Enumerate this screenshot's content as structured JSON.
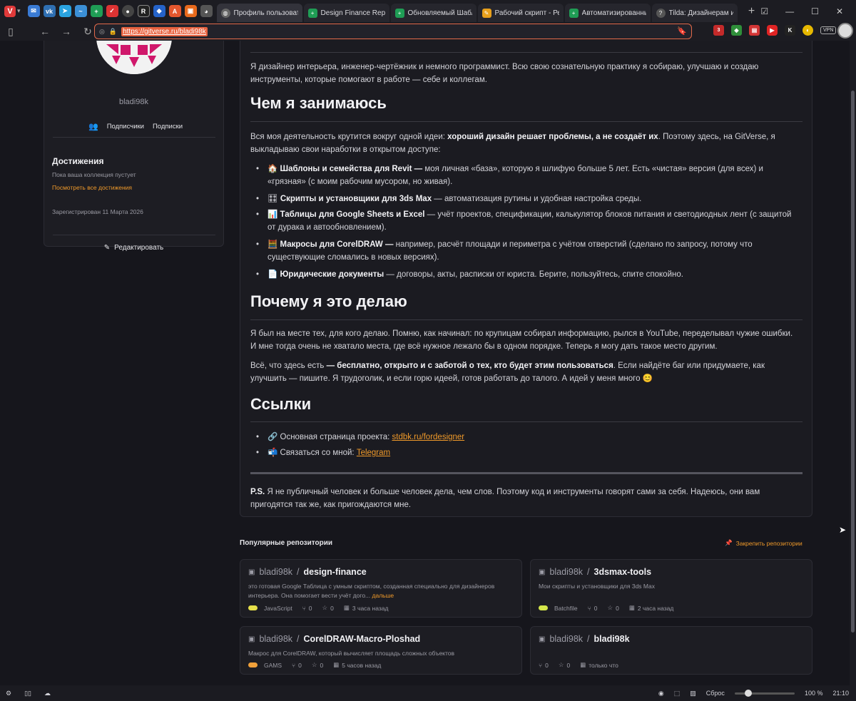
{
  "browser": {
    "tabs": [
      {
        "title": "Профиль пользователя G",
        "active": true,
        "icon": "profile-tab-icon"
      },
      {
        "title": "Design Finance Repository",
        "active": false,
        "icon": "sheets-icon"
      },
      {
        "title": "Обновляемый Шаблон у",
        "active": false,
        "icon": "sheets-icon"
      },
      {
        "title": "Рабочий скрипт - Редакт",
        "active": false,
        "icon": "script-icon"
      },
      {
        "title": "Автоматизированный Ка",
        "active": false,
        "icon": "sheets-icon"
      },
      {
        "title": "Tilda: Дизайнерам и студ",
        "active": false,
        "icon": "help-icon"
      }
    ],
    "url": "https://gitverse.ru/bladi98k",
    "vpn_label": "VPN",
    "badge_count": "3"
  },
  "profile": {
    "username": "bladi98k",
    "followers_label": "Подписчики",
    "following_label": "Подписки",
    "achievements_title": "Достижения",
    "achievements_empty": "Пока ваша коллекция пустует",
    "achievements_link": "Посмотреть все достижения",
    "registered": "Зарегистрирован 11 Марта 2026",
    "edit_label": "Редактировать"
  },
  "readme": {
    "intro": "Я дизайнер интерьера, инженер-чертёжник и немного программист. Всю свою сознательную практику я собираю, улучшаю и создаю инструменты, которые помогают в работе — себе и коллегам.",
    "h_what": "Чем я занимаюсь",
    "what_p_a": "Вся моя деятельность крутится вокруг одной идеи: ",
    "what_p_b": "хороший дизайн решает проблемы, а не создаёт их",
    "what_p_c": ". Поэтому здесь, на GitVerse, я выкладываю свои наработки в открытом доступе:",
    "items": [
      {
        "emoji": "🏠",
        "bold": "Шаблоны и семейства для Revit —",
        "text": " моя личная «база», которую я шлифую больше 5 лет. Есть «чистая» версия (для всех) и «грязная» (с моим рабочим мусором, но живая)."
      },
      {
        "emoji": "🎛",
        "bold": "Скрипты и установщики для 3ds Max",
        "text": " — автоматизация рутины и удобная настройка среды."
      },
      {
        "emoji": "📊",
        "bold": "Таблицы для Google Sheets и Excel",
        "text": " — учёт проектов, спецификации, калькулятор блоков питания и светодиодных лент (с защитой от дурака и автообновлением)."
      },
      {
        "emoji": "🧮",
        "bold": "Макросы для CorelDRAW —",
        "text": " например, расчёт площади и периметра с учётом отверстий (сделано по запросу, потому что существующие сломались в новых версиях)."
      },
      {
        "emoji": "📄",
        "bold": "Юридические документы",
        "text": " — договоры, акты, расписки от юриста. Берите, пользуйтесь, спите спокойно."
      }
    ],
    "h_why": "Почему я это делаю",
    "why_p1": "Я был на месте тех, для кого делаю. Помню, как начинал: по крупицам собирал информацию, рылся в YouTube, переделывал чужие ошибки. И мне тогда очень не хватало места, где всё нужное лежало бы в одном порядке. Теперь я могу дать такое место другим.",
    "why_p2_a": "Всё, что здесь есть ",
    "why_p2_b": "— бесплатно, открыто и с заботой о тех, кто будет этим пользоваться",
    "why_p2_c": ". Если найдёте баг или придумаете, как улучшить — пишите. Я трудоголик, и если горю идеей, готов работать до талого. А идей у меня много 😊",
    "h_links": "Ссылки",
    "link1_label": "🔗 Основная страница проекта: ",
    "link1_text": "stdbk.ru/fordesigner",
    "link2_label": "📬 Связаться со мной: ",
    "link2_text": "Telegram",
    "ps_bold": "P.S.",
    "ps_text": " Я не публичный человек и больше человек дела, чем слов. Поэтому код и инструменты говорят сами за себя. Надеюсь, они вам пригодятся так же, как пригождаются мне."
  },
  "repos": {
    "title": "Популярные репозитории",
    "pin_label": "Закрепить репозитории",
    "owner": "bladi98k",
    "sep": "/",
    "cards": [
      {
        "name": "design-finance",
        "desc": "это готовая Google Таблица с умным скриптом, созданная специально для дизайнеров интерьера. Она помогает вести учёт дого...",
        "more": "дальше",
        "lang": "JavaScript",
        "lang_color": "#e6e04a",
        "forks": "0",
        "stars": "0",
        "updated": "3 часа назад"
      },
      {
        "name": "3dsmax-tools",
        "desc": "Мои скрипты и установщики для 3ds Max",
        "more": "",
        "lang": "Batchfile",
        "lang_color": "#d4e64a",
        "forks": "0",
        "stars": "0",
        "updated": "2 часа назад"
      },
      {
        "name": "CorelDRAW-Macro-Ploshad",
        "desc": "Макрос для CorelDRAW, который вычисляет площадь сложных объектов",
        "more": "",
        "lang": "GAMS",
        "lang_color": "#f0a03a",
        "forks": "0",
        "stars": "0",
        "updated": "5 часов назад"
      },
      {
        "name": "bladi98k",
        "desc": "",
        "more": "",
        "lang": "",
        "lang_color": "",
        "forks": "0",
        "stars": "0",
        "updated": "только что"
      }
    ]
  },
  "status": {
    "reset_label": "Сброс",
    "zoom": "100 %",
    "time": "21:10"
  }
}
